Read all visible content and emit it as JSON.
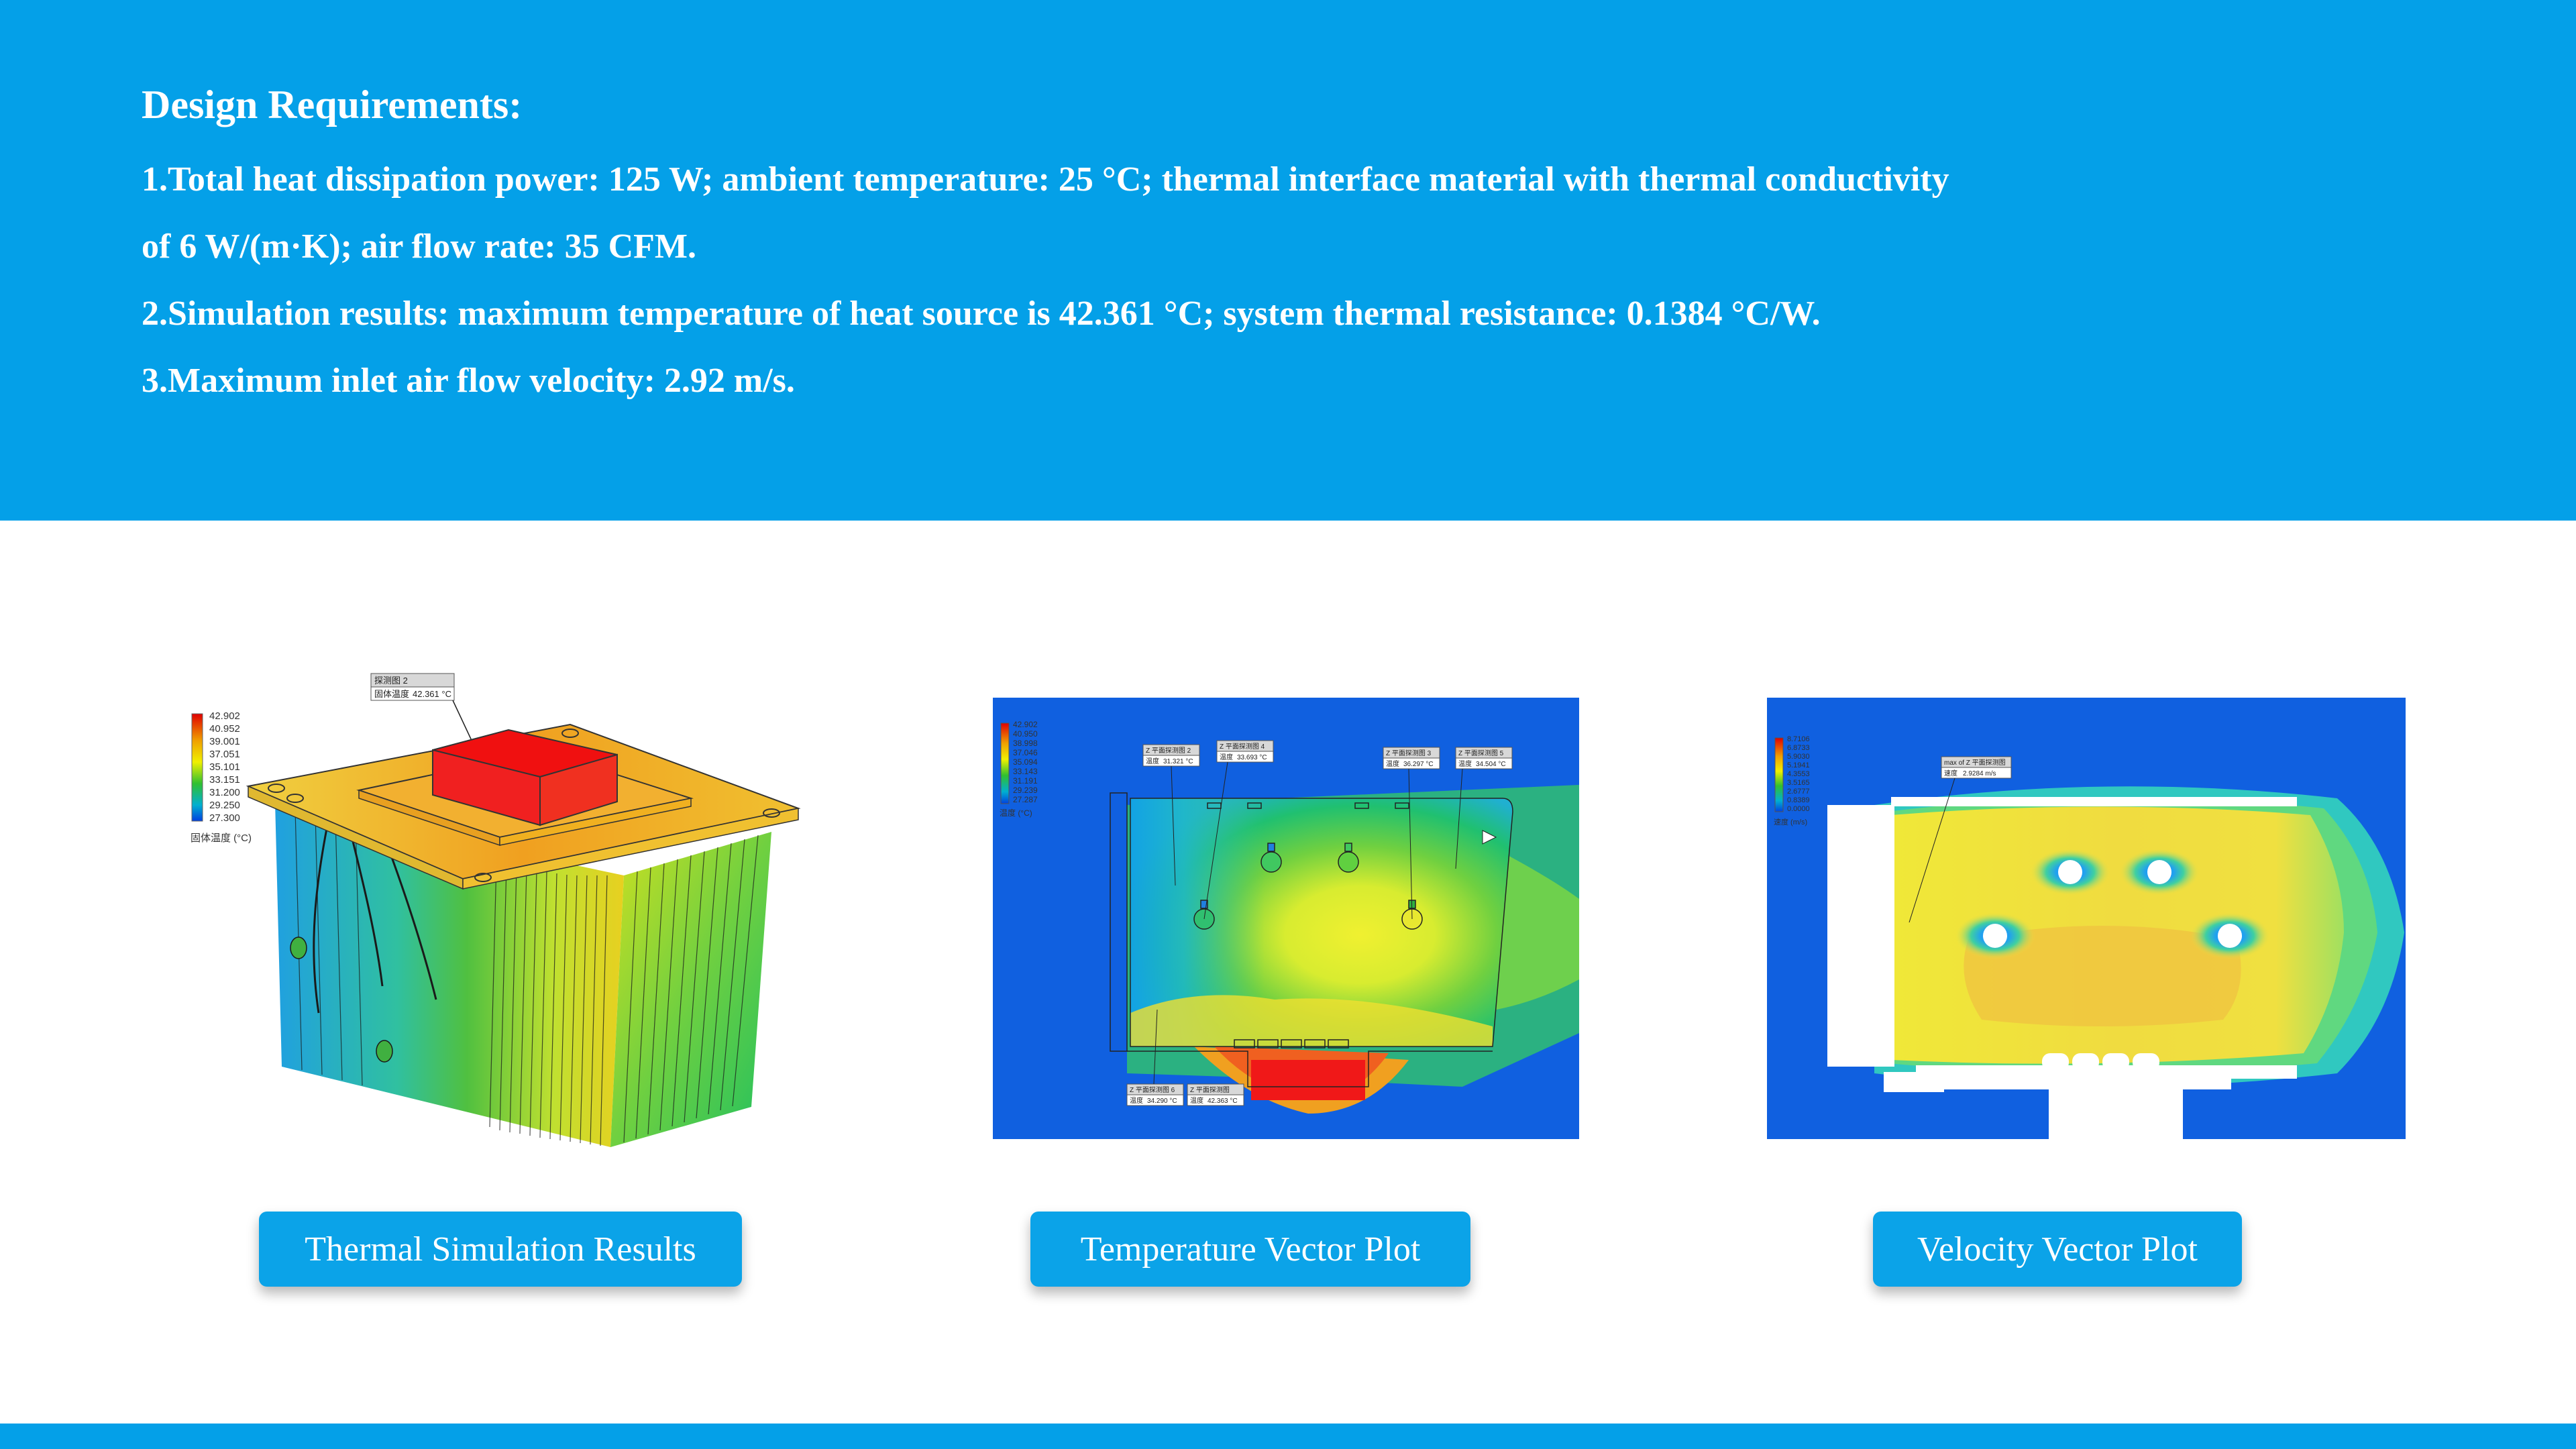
{
  "header": {
    "title": "Design Requirements:",
    "lines": [
      "1.Total heat dissipation power: 125 W; ambient temperature: 25 °C; thermal interface material with thermal conductivity",
      "of 6 W/(m·K); air flow rate: 35 CFM.",
      "2.Simulation results: maximum temperature of heat source is 42.361 °C; system thermal resistance: 0.1384 °C/W.",
      "3.Maximum inlet air flow velocity: 2.92 m/s."
    ]
  },
  "panels": {
    "thermal": {
      "legend_values": [
        "42.902",
        "40.952",
        "39.001",
        "37.051",
        "35.101",
        "33.151",
        "31.200",
        "29.250",
        "27.300"
      ],
      "legend_unit": "固体温度 (°C)",
      "probe_title": "探测图 2",
      "probe_label": "固体温度",
      "probe_value": "42.361 °C"
    },
    "temperature": {
      "legend_values": [
        "42.902",
        "40.950",
        "38.998",
        "37.046",
        "35.094",
        "33.143",
        "31.191",
        "29.239",
        "27.287"
      ],
      "legend_unit": "温度 (°C)",
      "probes": [
        {
          "title": "Z 平面探测图 2",
          "label": "温度",
          "value": "31.321 °C"
        },
        {
          "title": "Z 平面探测图 4",
          "label": "温度",
          "value": "33.693 °C"
        },
        {
          "title": "Z 平面探测图 3",
          "label": "温度",
          "value": "36.297 °C"
        },
        {
          "title": "Z 平面探测图 5",
          "label": "温度",
          "value": "34.504 °C"
        },
        {
          "title": "Z 平面探测图 6",
          "label": "温度",
          "value": "34.290 °C"
        },
        {
          "title": "Z 平面探测图",
          "label": "温度",
          "value": "42.363 °C"
        }
      ]
    },
    "velocity": {
      "legend_values": [
        "8.7106",
        "6.8733",
        "5.9030",
        "5.1941",
        "4.3553",
        "3.5165",
        "2.6777",
        "0.8389",
        "0.0000"
      ],
      "legend_unit": "速度 (m/s)",
      "probe_title": "max of Z 平面探测图",
      "probe_label": "速度",
      "probe_value": "2.9284 m/s"
    }
  },
  "captions": {
    "thermal": "Thermal Simulation Results",
    "temperature": "Temperature Vector Plot",
    "velocity": "Velocity Vector Plot"
  },
  "colors": {
    "brand_blue": "#04a0e8",
    "button_blue": "#0ba3e8",
    "sim_background": "#1060e0"
  }
}
